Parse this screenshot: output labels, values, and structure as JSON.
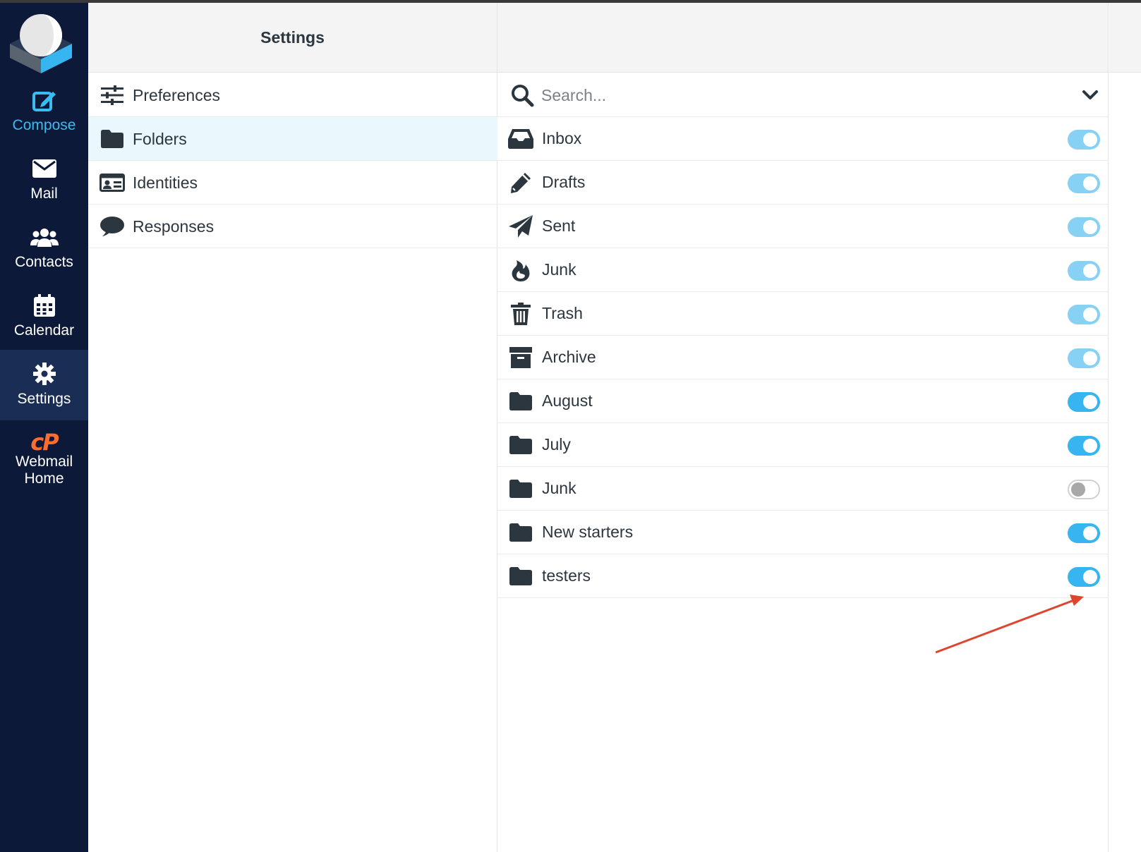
{
  "app": {
    "nav": [
      {
        "label": "Compose",
        "icon": "compose-icon"
      },
      {
        "label": "Mail",
        "icon": "envelope-icon"
      },
      {
        "label": "Contacts",
        "icon": "users-icon"
      },
      {
        "label": "Calendar",
        "icon": "calendar-icon"
      },
      {
        "label": "Settings",
        "icon": "gear-icon"
      },
      {
        "label": "Webmail Home",
        "icon": "cpanel-icon",
        "logo_text": "cP"
      }
    ],
    "active_nav": "Settings"
  },
  "settings": {
    "title": "Settings",
    "items": [
      {
        "label": "Preferences",
        "icon": "sliders-icon"
      },
      {
        "label": "Folders",
        "icon": "folder-icon",
        "selected": true
      },
      {
        "label": "Identities",
        "icon": "id-card-icon"
      },
      {
        "label": "Responses",
        "icon": "comment-icon"
      }
    ]
  },
  "folders": {
    "search_placeholder": "Search...",
    "list": [
      {
        "name": "Inbox",
        "icon": "inbox-icon",
        "subscribed": true,
        "locked": true
      },
      {
        "name": "Drafts",
        "icon": "pencil-icon",
        "subscribed": true,
        "locked": true
      },
      {
        "name": "Sent",
        "icon": "paper-plane-icon",
        "subscribed": true,
        "locked": true
      },
      {
        "name": "Junk",
        "icon": "fire-icon",
        "subscribed": true,
        "locked": true
      },
      {
        "name": "Trash",
        "icon": "trash-icon",
        "subscribed": true,
        "locked": true
      },
      {
        "name": "Archive",
        "icon": "archive-icon",
        "subscribed": true,
        "locked": true
      },
      {
        "name": "August",
        "icon": "folder-icon",
        "subscribed": true,
        "locked": false
      },
      {
        "name": "July",
        "icon": "folder-icon",
        "subscribed": true,
        "locked": false
      },
      {
        "name": "Junk",
        "icon": "folder-icon",
        "subscribed": false,
        "locked": false
      },
      {
        "name": "New starters",
        "icon": "folder-icon",
        "subscribed": true,
        "locked": false
      },
      {
        "name": "testers",
        "icon": "folder-icon",
        "subscribed": true,
        "locked": false
      }
    ]
  },
  "colors": {
    "nav_bg": "#0c1939",
    "accent": "#37b5f0",
    "annotation_arrow": "#e0442c"
  }
}
